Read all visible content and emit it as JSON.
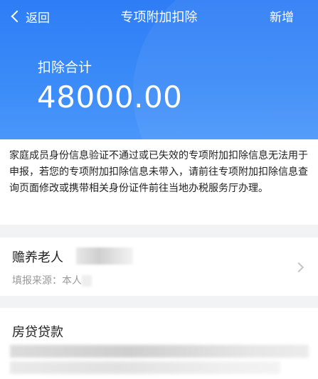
{
  "nav": {
    "back_label": "返回",
    "title": "专项附加扣除",
    "add_label": "新增"
  },
  "summary": {
    "label": "扣除合计",
    "amount": "48000.00"
  },
  "notice": {
    "text": "家庭成员身份信息验证不通过或已失效的专项附加扣除信息无法用于申报，若您的专项附加扣除信息未带入，请前往专项附加扣除信息查询页面修改或携带相关身份证件前往当地办税服务厅办理。"
  },
  "items": [
    {
      "title": "赡养老人",
      "source": "填报来源：本人"
    },
    {
      "title": "房贷贷款"
    }
  ],
  "colors": {
    "header_blue": "#2f7df6",
    "page_bg": "#f2f3f5"
  }
}
